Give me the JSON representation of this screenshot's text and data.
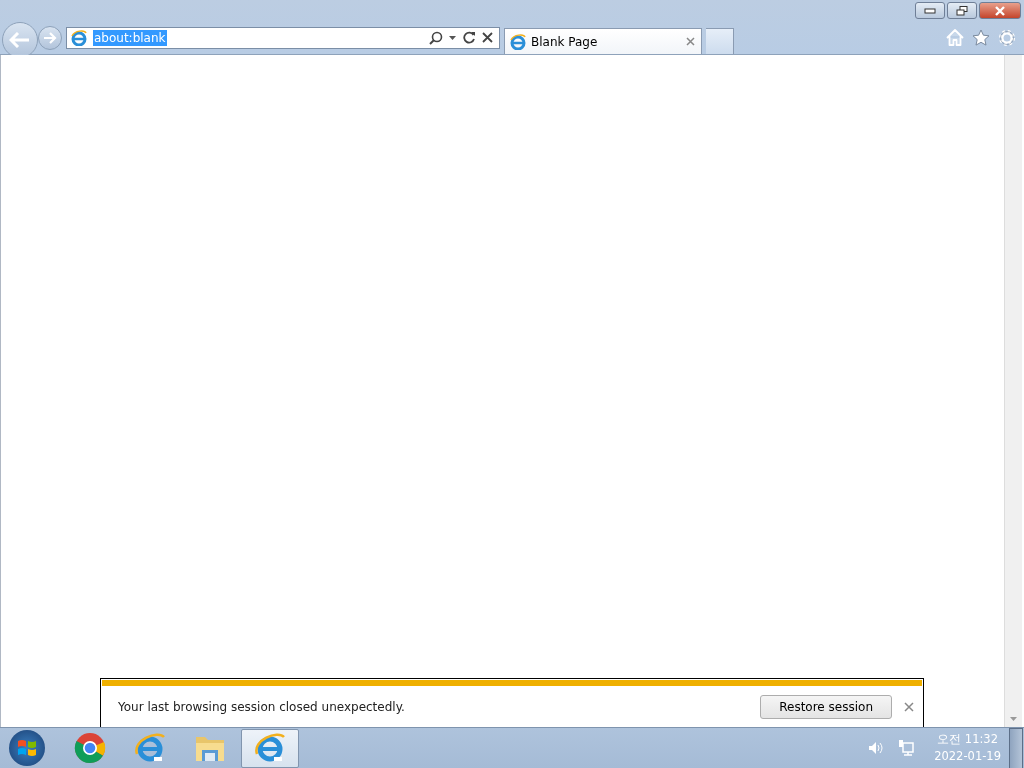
{
  "address_bar": {
    "value": "about:blank",
    "text_selected": true
  },
  "tabs": [
    {
      "label": "Blank Page",
      "selected": true
    }
  ],
  "notification": {
    "message": "Your last browsing session closed unexpectedly.",
    "button": "Restore session"
  },
  "taskbar": {
    "items": [
      {
        "kind": "chrome",
        "selected": false
      },
      {
        "kind": "ie",
        "selected": false
      },
      {
        "kind": "folder",
        "selected": false
      },
      {
        "kind": "ie",
        "selected": true
      }
    ],
    "clock": {
      "time": "오전 11:32",
      "date": "2022-01-19"
    }
  }
}
